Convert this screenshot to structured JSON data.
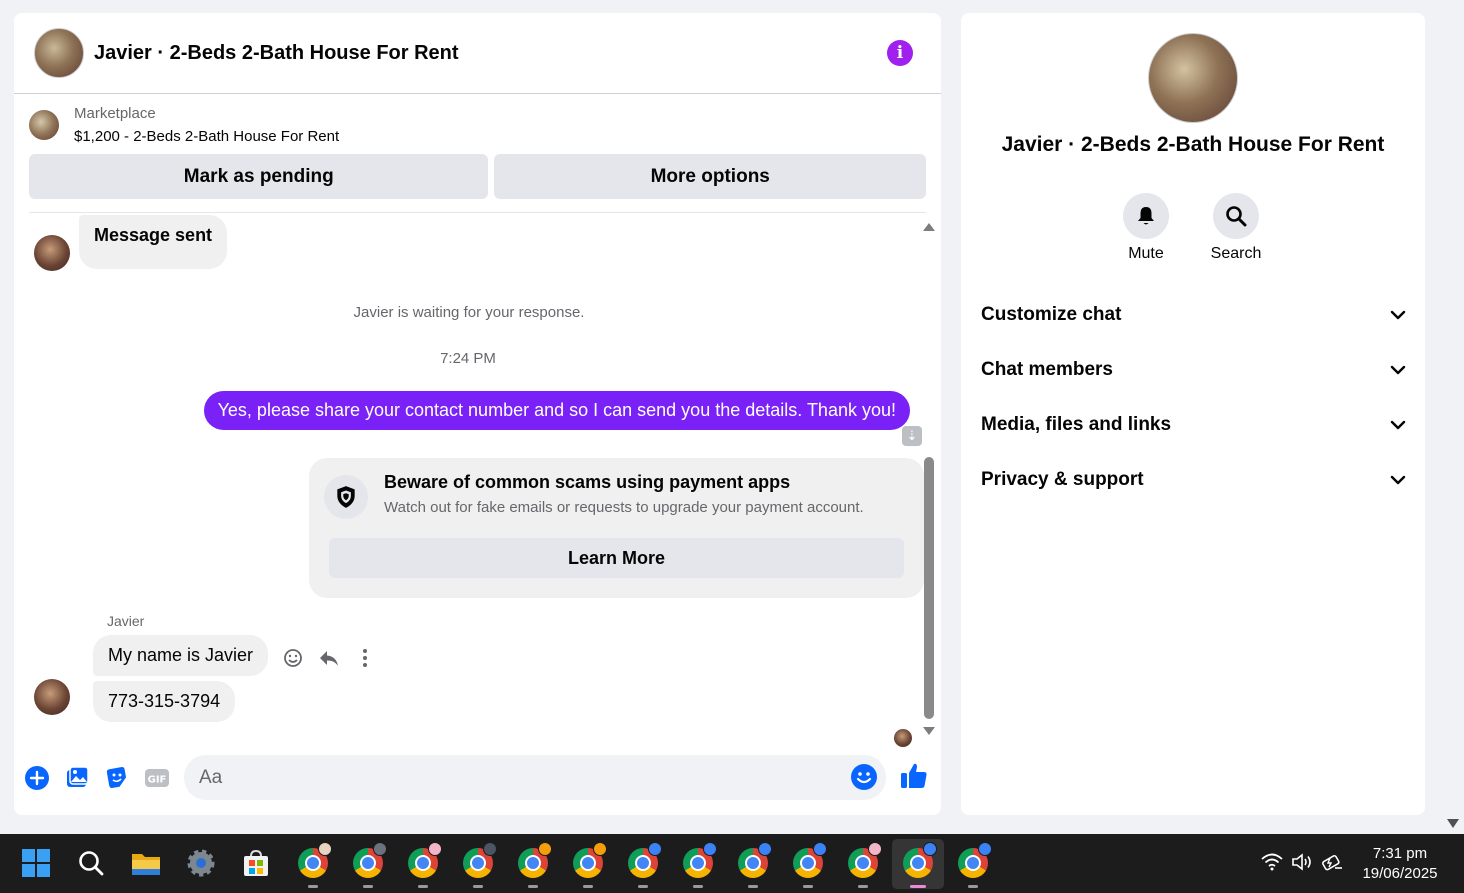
{
  "chat": {
    "title": "Javier · 2-Beds 2-Bath House For Rent",
    "marketplace_label": "Marketplace",
    "listing": "$1,200 - 2-Beds 2-Bath House For Rent",
    "mark_pending_label": "Mark as pending",
    "more_options_label": "More options"
  },
  "messages": {
    "message_sent": "Message sent",
    "waiting_notice": "Javier is waiting for your response.",
    "timestamp": "7:24 PM",
    "outgoing": "Yes, please share your contact number and so I can send you the details. Thank you!",
    "scam_title": "Beware of common scams using payment apps",
    "scam_subtitle": "Watch out for fake emails or requests to upgrade your payment account.",
    "learn_more_label": "Learn More",
    "sender_name": "Javier",
    "incoming_1": "My name is Javier",
    "incoming_2": "773-315-3794"
  },
  "composer": {
    "placeholder": "Aa",
    "icons": [
      "plus-icon",
      "photo-icon",
      "sticker-icon",
      "gif-icon",
      "emoji-icon",
      "like-icon"
    ]
  },
  "sidebar": {
    "title": "Javier · 2-Beds 2-Bath House For Rent",
    "mute_label": "Mute",
    "search_label": "Search",
    "sections": [
      "Customize chat",
      "Chat members",
      "Media, files and links",
      "Privacy & support"
    ]
  },
  "taskbar": {
    "time": "7:31 pm",
    "date": "19/06/2025",
    "apps": [
      "start-icon",
      "search-icon",
      "file-explorer-icon",
      "settings-icon",
      "store-icon",
      "chrome-icon"
    ]
  },
  "colors": {
    "accent_purple": "#7a21f7",
    "info_purple": "#a020f0",
    "messenger_blue": "#0866ff"
  }
}
